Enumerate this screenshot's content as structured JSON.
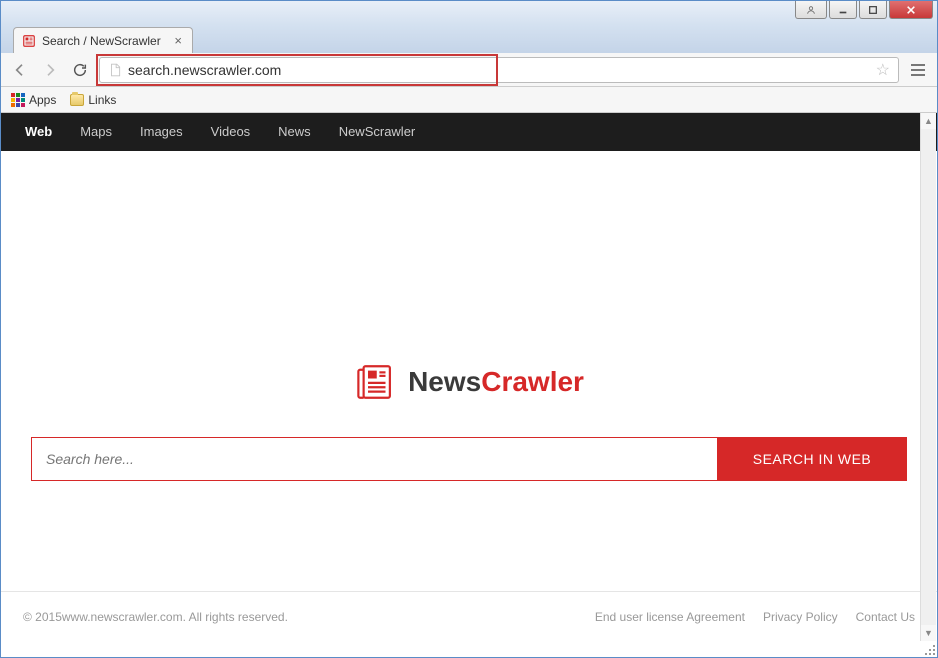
{
  "window": {
    "tab_title": "Search / NewScrawler"
  },
  "address_bar": {
    "url": "search.newscrawler.com"
  },
  "bookmark_bar": {
    "apps_label": "Apps",
    "links_label": "Links"
  },
  "page_nav": {
    "items": [
      {
        "label": "Web",
        "active": true
      },
      {
        "label": "Maps",
        "active": false
      },
      {
        "label": "Images",
        "active": false
      },
      {
        "label": "Videos",
        "active": false
      },
      {
        "label": "News",
        "active": false
      },
      {
        "label": "NewScrawler",
        "active": false
      }
    ]
  },
  "logo": {
    "part1": "News",
    "part2": "Crawler"
  },
  "search": {
    "placeholder": "Search here...",
    "button_label": "SEARCH IN WEB"
  },
  "footer": {
    "copyright": "© 2015www.newscrawler.com. All rights reserved.",
    "links": [
      "End user license Agreement",
      "Privacy Policy",
      "Contact Us"
    ]
  }
}
